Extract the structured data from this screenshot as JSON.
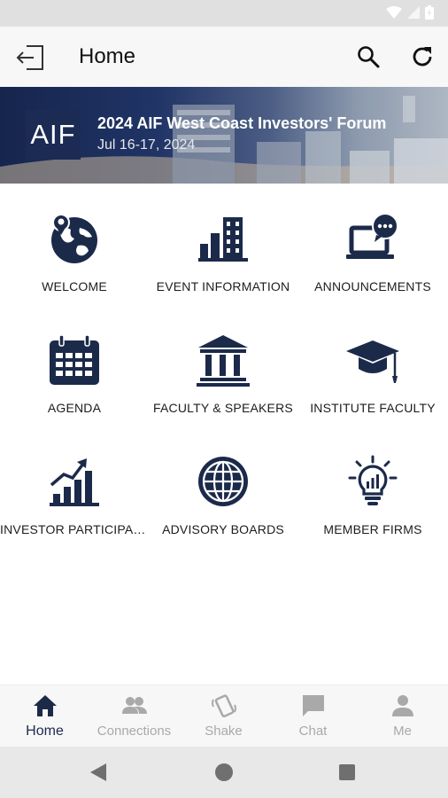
{
  "app_bar": {
    "title": "Home"
  },
  "banner": {
    "logo_text": "AIF",
    "event_title": "2024 AIF West Coast Investors' Forum",
    "event_dates": "Jul 16-17, 2024"
  },
  "tiles": [
    {
      "label": "WELCOME",
      "icon": "globe-pin-icon"
    },
    {
      "label": "EVENT INFORMATION",
      "icon": "city-buildings-icon"
    },
    {
      "label": "ANNOUNCEMENTS",
      "icon": "laptop-chat-icon"
    },
    {
      "label": "AGENDA",
      "icon": "calendar-icon"
    },
    {
      "label": "FACULTY & SPEAKERS",
      "icon": "institution-icon"
    },
    {
      "label": "INSTITUTE FACULTY",
      "icon": "graduation-cap-icon"
    },
    {
      "label": "INVESTOR PARTICIPANTS",
      "icon": "growth-chart-icon"
    },
    {
      "label": "ADVISORY BOARDS",
      "icon": "globe-icon"
    },
    {
      "label": "MEMBER FIRMS",
      "icon": "lightbulb-chart-icon"
    }
  ],
  "bottom_nav": [
    {
      "label": "Home",
      "icon": "home-icon",
      "active": true
    },
    {
      "label": "Connections",
      "icon": "people-icon",
      "active": false
    },
    {
      "label": "Shake",
      "icon": "shake-phone-icon",
      "active": false
    },
    {
      "label": "Chat",
      "icon": "chat-icon",
      "active": false
    },
    {
      "label": "Me",
      "icon": "person-icon",
      "active": false
    }
  ],
  "colors": {
    "primary": "#1c2a4a",
    "inactive": "#a9a9a9",
    "banner_dark": "#16254d"
  }
}
